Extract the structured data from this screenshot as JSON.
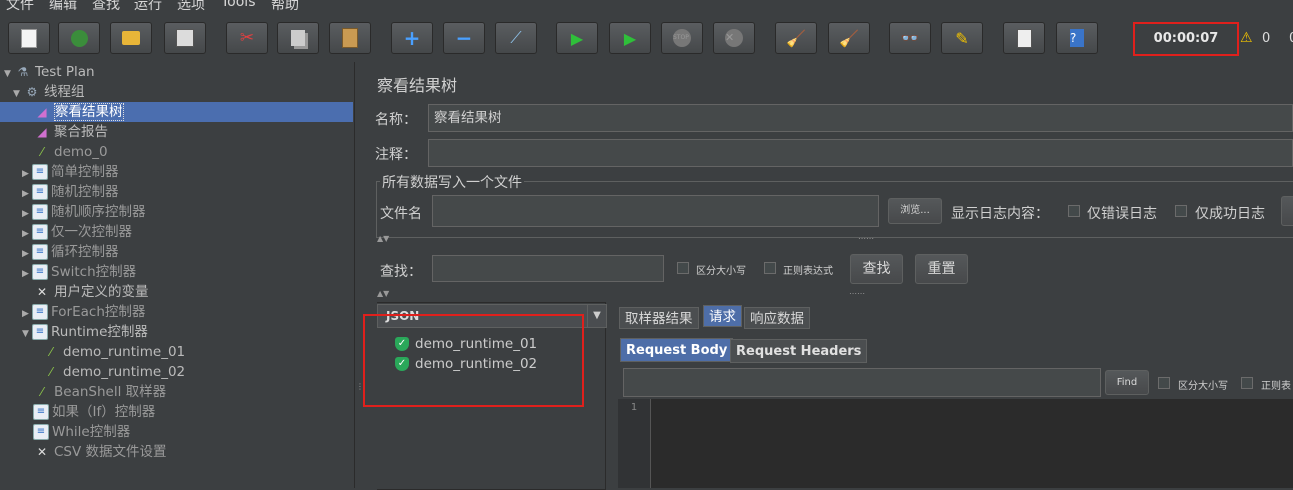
{
  "menu": [
    "文件",
    "编辑",
    "查找",
    "运行",
    "选项",
    "Tools",
    "帮助"
  ],
  "toolbar": {
    "timer": "00:00:07",
    "warning_count": "0",
    "error_count": "0",
    "buttons": [
      "new-icon",
      "templates-icon",
      "open-icon",
      "save-icon",
      "cut-icon",
      "copy-icon",
      "paste-icon",
      "expand-icon",
      "collapse-icon",
      "toggle-icon",
      "start-icon",
      "start-no-pause-icon",
      "stop-icon",
      "shutdown-icon",
      "clear-icon",
      "clear-all-icon",
      "search-icon",
      "reset-search-icon",
      "function-helper-icon",
      "help-icon"
    ]
  },
  "tree": {
    "items": [
      {
        "label": "Test Plan",
        "icon": "flask-icon"
      },
      {
        "label": "线程组",
        "icon": "gear-icon"
      },
      {
        "label": "察看结果树",
        "icon": "chart-icon"
      },
      {
        "label": "聚合报告",
        "icon": "chart-icon"
      },
      {
        "label": "demo_0",
        "icon": "sampler-icon"
      },
      {
        "label": "简单控制器",
        "icon": "controller-icon"
      },
      {
        "label": "随机控制器",
        "icon": "controller-icon"
      },
      {
        "label": "随机顺序控制器",
        "icon": "controller-icon"
      },
      {
        "label": "仅一次控制器",
        "icon": "controller-icon"
      },
      {
        "label": "循环控制器",
        "icon": "controller-icon"
      },
      {
        "label": "Switch控制器",
        "icon": "controller-icon"
      },
      {
        "label": "用户定义的变量",
        "icon": "wrench-icon"
      },
      {
        "label": "ForEach控制器",
        "icon": "controller-icon"
      },
      {
        "label": "Runtime控制器",
        "icon": "controller-icon"
      },
      {
        "label": "demo_runtime_01",
        "icon": "sampler-icon"
      },
      {
        "label": "demo_runtime_02",
        "icon": "sampler-icon"
      },
      {
        "label": "BeanShell 取样器",
        "icon": "sampler-icon"
      },
      {
        "label": "如果（If）控制器",
        "icon": "controller-icon"
      },
      {
        "label": "While控制器",
        "icon": "controller-icon"
      },
      {
        "label": "CSV 数据文件设置",
        "icon": "wrench-icon"
      }
    ]
  },
  "panel": {
    "title": "察看结果树",
    "name_label": "名称：",
    "name_value": "察看结果树",
    "comment_label": "注释：",
    "comment_value": "",
    "file_group_label": "所有数据写入一个文件",
    "filename_label": "文件名",
    "filename_value": "",
    "browse_label": "浏览...",
    "log_label": "显示日志内容：",
    "errors_only_label": "仅错误日志",
    "success_only_label": "仅成功日志",
    "search_label": "查找：",
    "search_value": "",
    "case_sensitive_label": "区分大小写",
    "regex_label": "正则表达式",
    "search_button": "查找",
    "reset_button": "重置"
  },
  "results": {
    "renderer": "JSON",
    "items": [
      "demo_runtime_01",
      "demo_runtime_02"
    ]
  },
  "detail": {
    "tabs": [
      "取样器结果",
      "请求",
      "响应数据"
    ],
    "active_tab": "请求",
    "subtabs": [
      "Request Body",
      "Request Headers"
    ],
    "active_subtab": "Request Body",
    "find_value": "",
    "find_button": "Find",
    "case_sensitive_label": "区分大小写",
    "regex_label": "正则表",
    "line_number": "1"
  },
  "colors": {
    "background": "#3c3f41",
    "selection": "#4b6eaf",
    "highlight_border": "#e0201c",
    "success": "#2aa85a"
  }
}
